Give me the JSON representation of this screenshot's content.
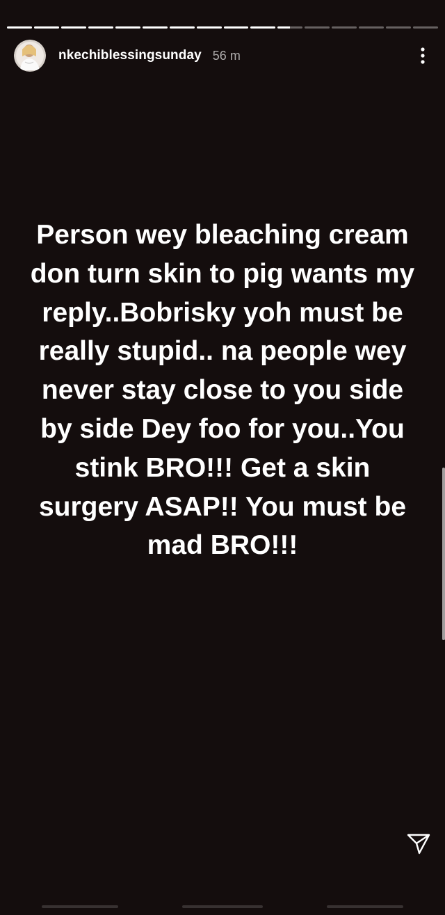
{
  "story": {
    "progress": {
      "segments_total": 16,
      "segments_done": 10,
      "current_fraction": 0.5
    },
    "header": {
      "username": "nkechiblessingsunday",
      "timestamp": "56 m",
      "avatar_icon": "profile-avatar",
      "more_icon": "more-vertical-icon"
    },
    "text": "Person wey bleaching cream don turn skin to pig wants my reply..Bobrisky yoh must be really stupid.. na people wey never stay close to you side by side Dey foo for you..You stink BRO!!! Get a skin surgery ASAP!! You must be mad BRO!!!",
    "share_icon": "send-icon"
  },
  "colors": {
    "background": "#140d0d",
    "text": "#ffffff",
    "timestamp": "#a6a6a6"
  }
}
